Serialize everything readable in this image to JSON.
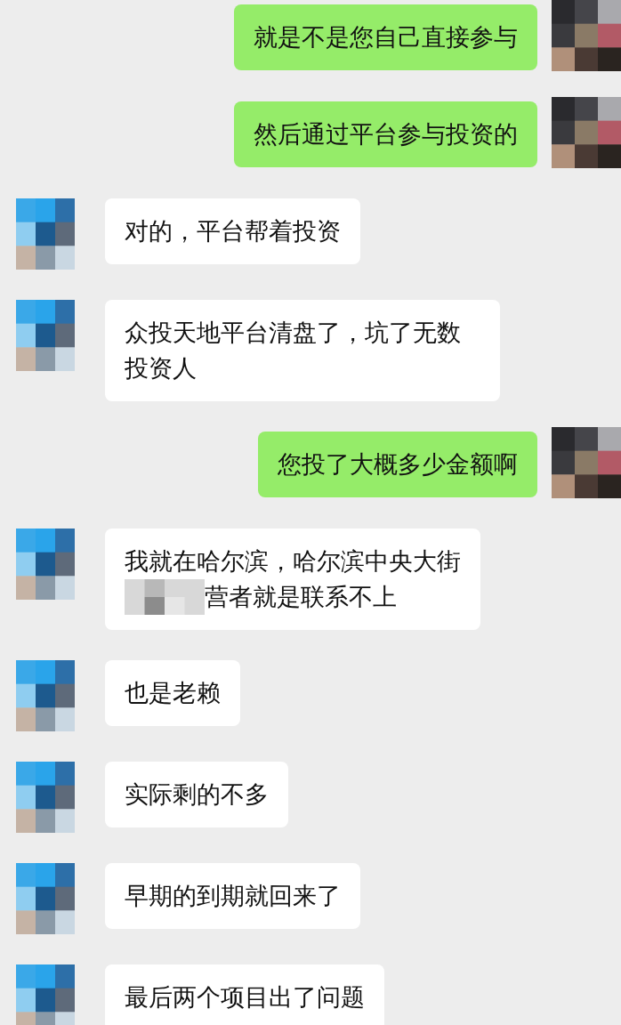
{
  "messages": [
    {
      "kind": "sent",
      "text": "就是不是您自己直接参与"
    },
    {
      "kind": "sent",
      "text": "然后通过平台参与投资的"
    },
    {
      "kind": "received",
      "text": "对的，平台帮着投资"
    },
    {
      "kind": "received",
      "text": "众投天地平台清盘了，坑了无数投资人"
    },
    {
      "kind": "sent",
      "text": "您投了大概多少金额啊"
    },
    {
      "kind": "received",
      "text": "我就在哈尔滨，哈尔滨中央大街",
      "redacted_text": "营者就是联系不上"
    },
    {
      "kind": "received",
      "text": "也是老赖"
    },
    {
      "kind": "received",
      "text": "实际剩的不多"
    },
    {
      "kind": "received",
      "text": "早期的到期就回来了"
    },
    {
      "kind": "received",
      "text": "最后两个项目出了问题"
    }
  ]
}
